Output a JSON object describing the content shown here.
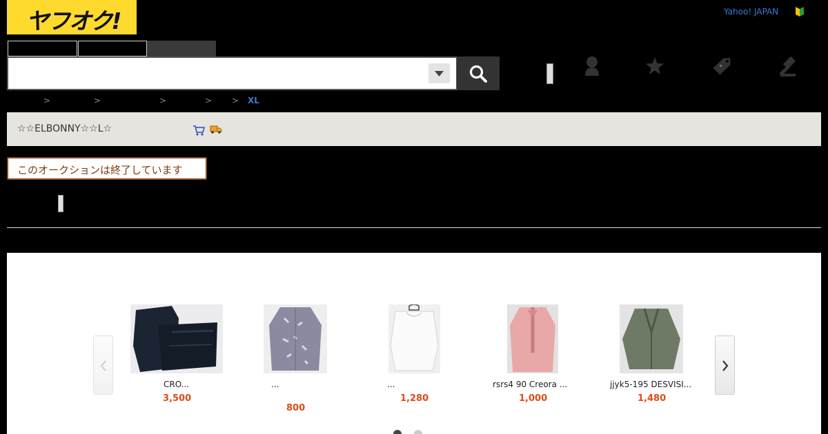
{
  "header": {
    "logo_text": "ヤフオク!",
    "yahoo_link": "Yahoo! JAPAN",
    "search": {
      "value": "",
      "placeholder": ""
    }
  },
  "breadcrumb": {
    "separators": [
      ">",
      ">",
      ">",
      ">",
      ">"
    ],
    "last": "XL"
  },
  "seller": {
    "name": "☆☆ELBONNY☆☆L☆"
  },
  "status": {
    "ended_text": "このオークションは終了しています"
  },
  "carousel": {
    "items": [
      {
        "title": "CRO...",
        "price": "3,500"
      },
      {
        "title": "...",
        "price": "800"
      },
      {
        "title": "...",
        "price": "1,280"
      },
      {
        "title": "rsrs4 90 Creora ...",
        "price": "1,000"
      },
      {
        "title": "jjyk5-195 DESVISI...",
        "price": "1,480"
      }
    ]
  },
  "icons": {
    "search": "search-icon",
    "dropdown": "chevron-down-icon",
    "user": "user-icon",
    "watch": "star-icon",
    "coupon": "tag-icon",
    "sell": "gavel-icon",
    "cart": "cart-icon",
    "shipping": "truck-icon"
  },
  "colors": {
    "brand_yellow": "#ffda2e",
    "price_red": "#e04a14",
    "link_blue": "#3b7ad0",
    "ended_brown": "#7a3c10"
  }
}
